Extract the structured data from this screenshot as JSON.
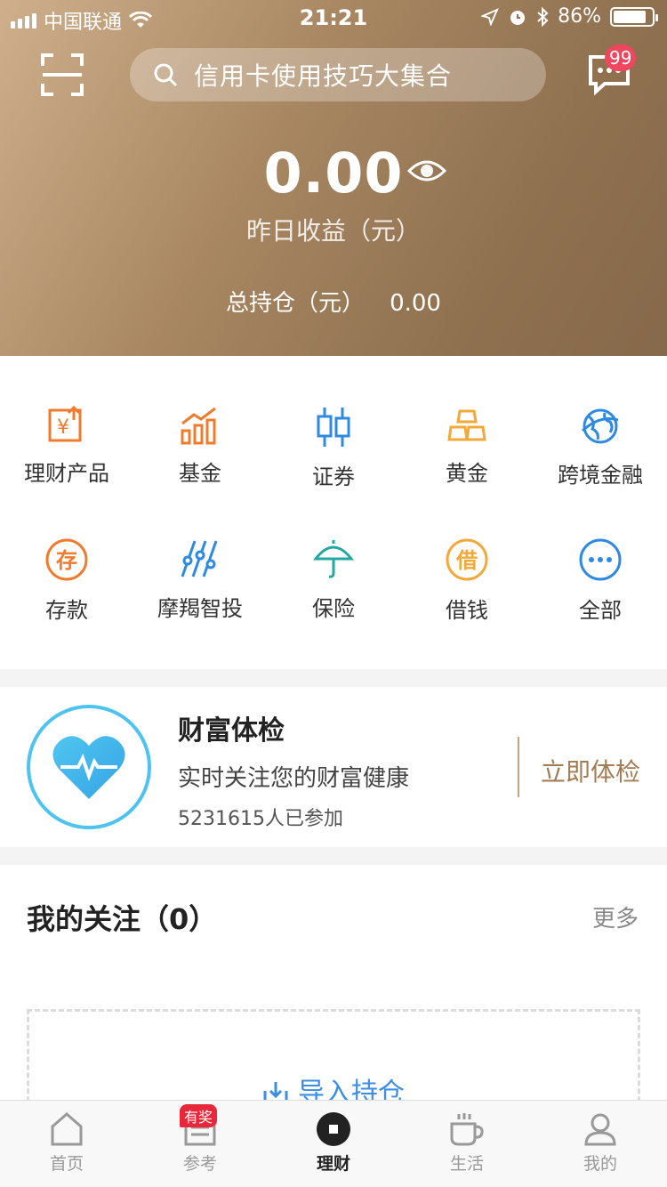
{
  "status_bar": {
    "carrier": "中国联通",
    "time": "21:21",
    "battery": "86%"
  },
  "header": {
    "search_placeholder": "信用卡使用技巧大集合",
    "message_badge": "99",
    "amount": "0.00",
    "amount_label": "昨日收益（元）",
    "total_label": "总持仓（元）",
    "total_value": "0.00"
  },
  "grid": {
    "items": [
      {
        "label": "理财产品",
        "icon": "wealth-product-icon",
        "color": "#ef7c2e"
      },
      {
        "label": "基金",
        "icon": "fund-chart-icon",
        "color": "#ef7c2e"
      },
      {
        "label": "证券",
        "icon": "candlestick-icon",
        "color": "#2d8ae0"
      },
      {
        "label": "黄金",
        "icon": "gold-bars-icon",
        "color": "#f3a83a"
      },
      {
        "label": "跨境金融",
        "icon": "globe-icon",
        "color": "#2d8ae0"
      },
      {
        "label": "存款",
        "icon": "deposit-icon",
        "color": "#ef7c2e"
      },
      {
        "label": "摩羯智投",
        "icon": "robo-advisor-icon",
        "color": "#2d8ae0"
      },
      {
        "label": "保险",
        "icon": "umbrella-icon",
        "color": "#22a8a0"
      },
      {
        "label": "借钱",
        "icon": "borrow-icon",
        "color": "#f3a83a"
      },
      {
        "label": "全部",
        "icon": "more-dots-icon",
        "color": "#2d8ae0"
      }
    ],
    "deposit_char": "存",
    "borrow_char": "借"
  },
  "wealth_check": {
    "title": "财富体检",
    "subtitle": "实时关注您的财富健康",
    "participants": "5231615人已参加",
    "action": "立即体检"
  },
  "follow": {
    "title": "我的关注（0）",
    "more": "更多",
    "import": "导入持仓"
  },
  "tabbar": {
    "tabs": [
      {
        "label": "首页",
        "icon": "home-icon"
      },
      {
        "label": "参考",
        "icon": "reference-icon",
        "badge": "有奖"
      },
      {
        "label": "理财",
        "icon": "wealth-icon",
        "active": true
      },
      {
        "label": "生活",
        "icon": "coffee-icon"
      },
      {
        "label": "我的",
        "icon": "profile-icon"
      }
    ]
  }
}
